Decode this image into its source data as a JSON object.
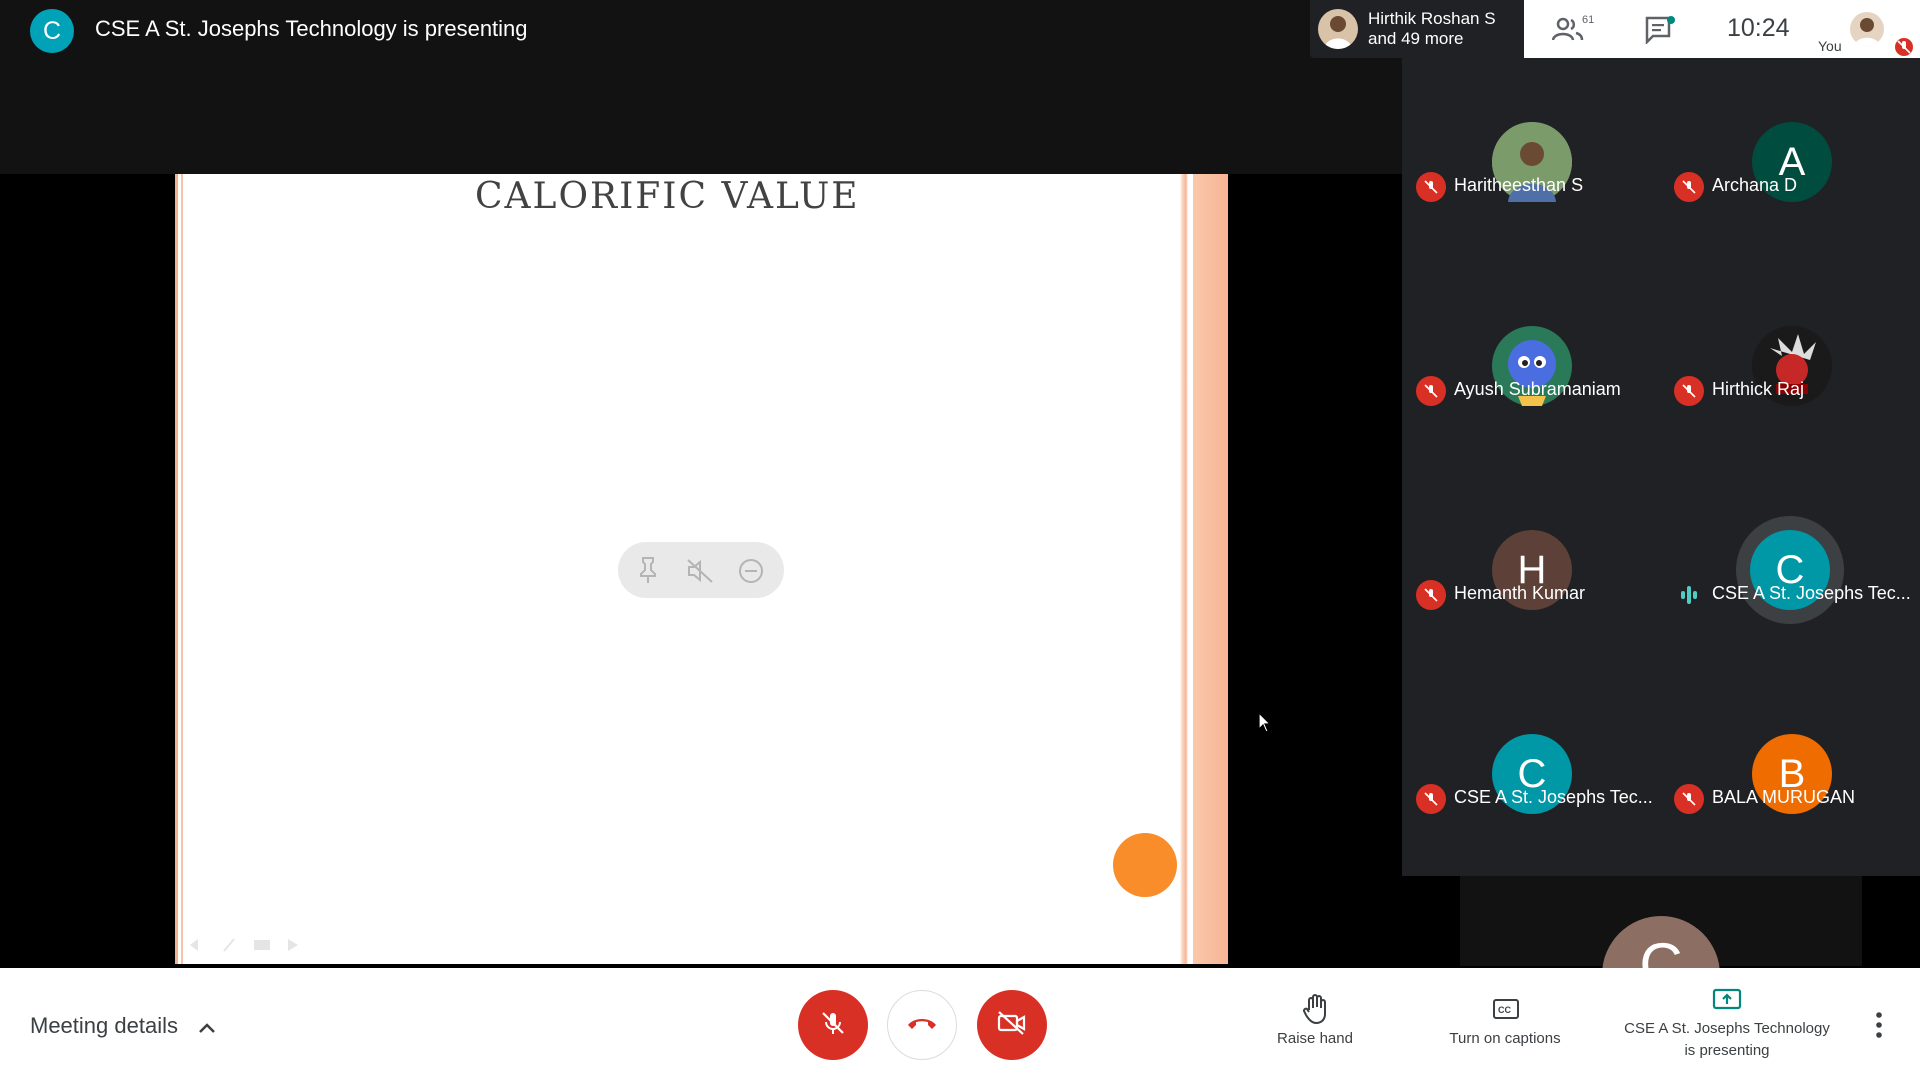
{
  "header": {
    "presenter_initial": "C",
    "title": "CSE A St. Josephs Technology is presenting"
  },
  "top_right": {
    "people_line1": "Hirthik Roshan S",
    "people_line2": "and 49 more",
    "participants_count": "61",
    "time": "10:24",
    "you_label": "You"
  },
  "slide": {
    "title": "CALORIFIC VALUE"
  },
  "participants": [
    {
      "name": "Haritheesthan S",
      "initial": "",
      "color": "#6d8fb0",
      "muted": true
    },
    {
      "name": "Archana D",
      "initial": "A",
      "color": "#004d40",
      "muted": true
    },
    {
      "name": "Ayush Subramaniam",
      "initial": "",
      "color": "#3a5bbf",
      "muted": true
    },
    {
      "name": "Hirthick Raj",
      "initial": "",
      "color": "#4a2020",
      "muted": true
    },
    {
      "name": "Hemanth Kumar",
      "initial": "H",
      "color": "#5d4037",
      "muted": true
    },
    {
      "name": "CSE A St. Josephs Tec...",
      "initial": "C",
      "color": "#0097a7",
      "muted": false
    },
    {
      "name": "CSE A St. Josephs Tec...",
      "initial": "C",
      "color": "#0097a7",
      "muted": true
    },
    {
      "name": "BALA MURUGAN",
      "initial": "B",
      "color": "#ef6c00",
      "muted": true
    }
  ],
  "peek": {
    "initial": "C"
  },
  "bottom": {
    "meeting_details": "Meeting details",
    "raise_hand": "Raise hand",
    "captions": "Turn on captions",
    "presenting_line1": "CSE A St. Josephs Technology",
    "presenting_line2": "is presenting"
  }
}
